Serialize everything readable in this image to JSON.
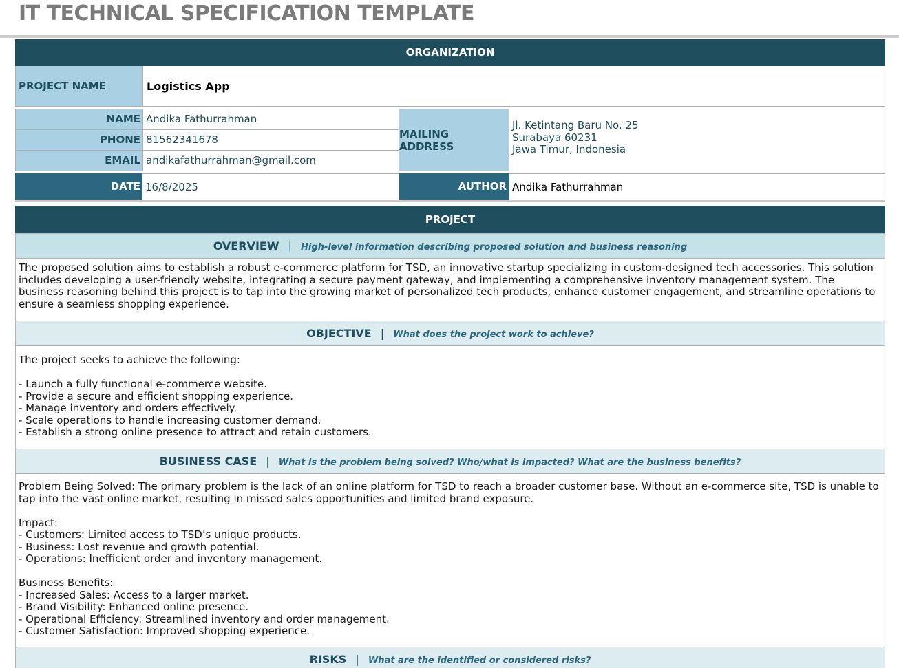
{
  "document": {
    "title": "IT TECHNICAL SPECIFICATION TEMPLATE"
  },
  "organization": {
    "header": "ORGANIZATION",
    "project_name_label": "PROJECT NAME",
    "project_name_value": "Logistics App",
    "name_label": "NAME",
    "name_value": "Andika Fathurrahman",
    "phone_label": "PHONE",
    "phone_value": "81562341678",
    "email_label": "EMAIL",
    "email_value": "andikafathurrahman@gmail.com",
    "mailing_address_label": "MAILING ADDRESS",
    "mailing_address_value": "Jl. Ketintang Baru No. 25\nSurabaya 60231\nJawa Timur, Indonesia",
    "date_label": "DATE",
    "date_value": "16/8/2025",
    "author_label": "AUTHOR",
    "author_value": "Andika Fathurrahman"
  },
  "project": {
    "header": "PROJECT",
    "sections": [
      {
        "title": "OVERVIEW",
        "separator": "|",
        "description": "High-level information describing proposed solution and business reasoning",
        "body": "The proposed solution aims to establish a robust e-commerce platform for TSD, an innovative startup specializing in custom-designed tech accessories. This solution includes developing a user-friendly website, integrating a secure payment gateway, and implementing a comprehensive inventory management system. The business reasoning behind this project is to tap into the growing market of personalized tech products, enhance customer engagement, and streamline operations to ensure a seamless shopping experience."
      },
      {
        "title": "OBJECTIVE",
        "separator": "|",
        "description": "What does the project work to achieve?",
        "body": "The project seeks to achieve the following:\n\n- Launch a fully functional e-commerce website.\n- Provide a secure and efficient shopping experience.\n- Manage inventory and orders effectively.\n- Scale operations to handle increasing customer demand.\n- Establish a strong online presence to attract and retain customers."
      },
      {
        "title": "BUSINESS CASE",
        "separator": "|",
        "description": "What is the problem being solved? Who/what is impacted? What are the business benefits?",
        "body": "Problem Being Solved: The primary problem is the lack of an online platform for TSD to reach a broader customer base. Without an e-commerce site, TSD is unable to tap into the vast online market, resulting in missed sales opportunities and limited brand exposure.\n\nImpact:\n- Customers: Limited access to TSD’s unique products.\n- Business: Lost revenue and growth potential.\n- Operations: Inefficient order and inventory management.\n\nBusiness Benefits:\n- Increased Sales: Access to a larger market.\n- Brand Visibility: Enhanced online presence.\n- Operational Efficiency: Streamlined inventory and order management.\n- Customer Satisfaction: Improved shopping experience."
      },
      {
        "title": "RISKS",
        "separator": "|",
        "description": "What are the identified or considered risks?",
        "body": ""
      }
    ]
  },
  "colors": {
    "header_dark": "#1f4e5f",
    "label_dark": "#2b6880",
    "label_light": "#a9d1e3",
    "subheader_light": "#dcecf0",
    "title_gray": "#7b7b7b"
  }
}
